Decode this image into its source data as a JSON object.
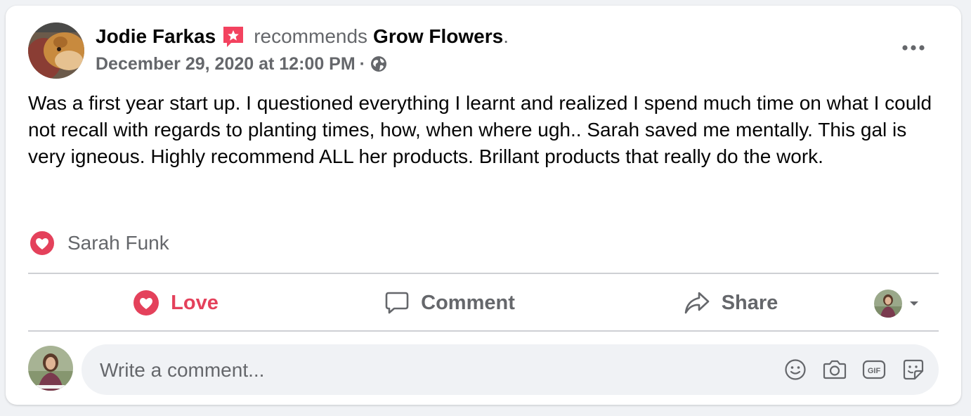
{
  "post": {
    "author": "Jodie Farkas",
    "action_text": "recommends",
    "page_name": "Grow Flowers",
    "page_name_suffix": ".",
    "timestamp": "December 29, 2020 at 12:00 PM",
    "meta_separator": "·",
    "privacy_icon": "globe-icon",
    "body": "Was a first year start up. I questioned everything I learnt and realized I spend much time on what I could not recall with regards to planting times, how, when where ugh.. Sarah saved me mentally. This gal is very igneous. Highly recommend ALL her products. Brillant products that really do the work."
  },
  "reactions": {
    "icon": "heart-icon",
    "names": "Sarah Funk"
  },
  "actions": {
    "love_label": "Love",
    "comment_label": "Comment",
    "share_label": "Share"
  },
  "comment_composer": {
    "placeholder": "Write a comment...",
    "icons": [
      "emoji-icon",
      "camera-icon",
      "gif-icon",
      "sticker-icon"
    ]
  },
  "colors": {
    "love_red": "#e4415b",
    "recommend_badge": "#f3425f",
    "secondary_text": "#65676b",
    "input_bg": "#f0f2f5"
  }
}
